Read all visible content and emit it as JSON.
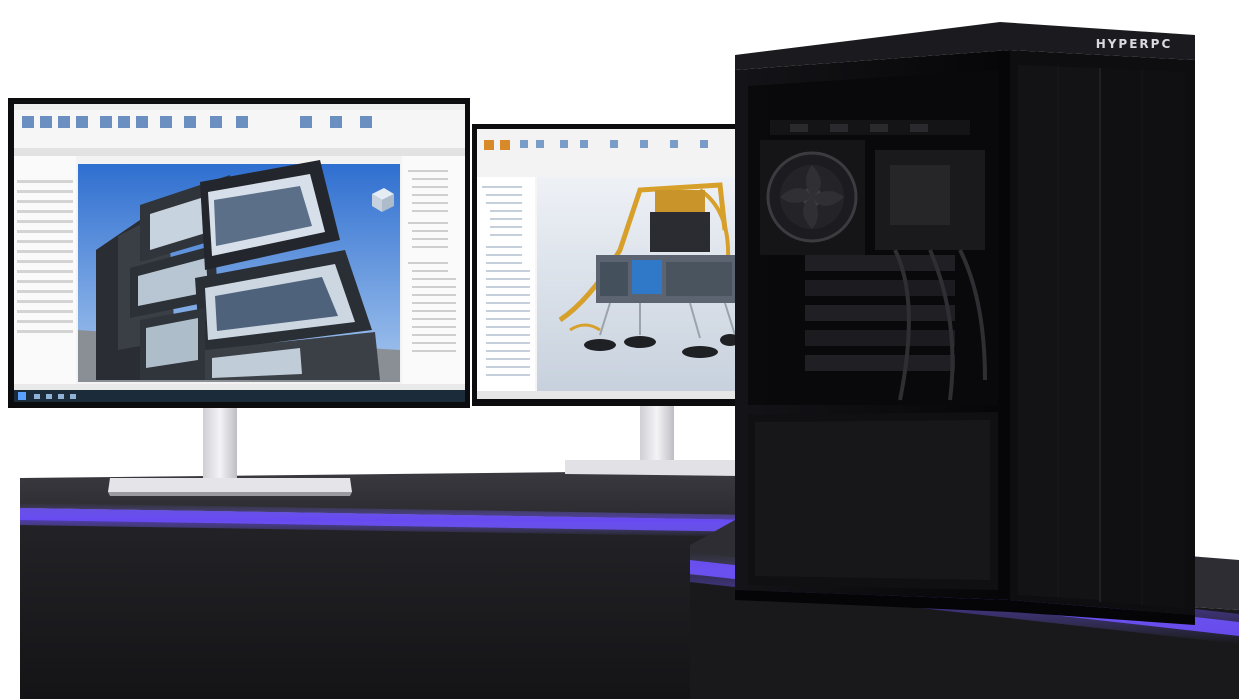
{
  "scene": {
    "brand_logo": "HYPERPC",
    "accent_glow_color": "#6b4cff",
    "pedestal_color": "#222226",
    "case_color": "#0d0d10",
    "monitor_stand_color": "#e8e8ec",
    "left_screen_app": "architecture-3d-viewer",
    "right_screen_app": "cad-assembly-viewer",
    "icons": [
      "windows-start-icon",
      "fan-icon",
      "viewcube-icon"
    ]
  }
}
